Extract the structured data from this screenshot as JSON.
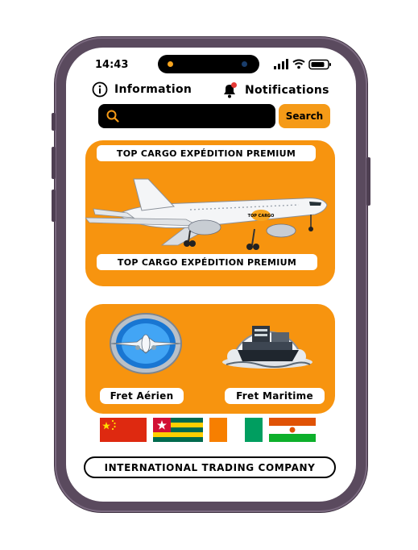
{
  "status_bar": {
    "time": "14:43"
  },
  "top_nav": {
    "information_label": "Information",
    "notifications_label": "Notifications"
  },
  "search": {
    "placeholder": "",
    "button_label": "Search"
  },
  "banner": {
    "title_top": "TOP CARGO EXPÉDITION PREMIUM",
    "title_bottom": "TOP CARGO EXPÉDITION PREMIUM",
    "plane_logo_text": "TOP CARGO"
  },
  "services": {
    "air_label": "Fret Aérien",
    "sea_label": "Fret Maritime"
  },
  "flags": [
    "China",
    "Togo",
    "Côte d'Ivoire",
    "Niger"
  ],
  "footer": {
    "company_label": "INTERNATIONAL TRADING COMPANY"
  },
  "colors": {
    "accent": "#f7940f",
    "search_bar": "#000000",
    "frame": "#5a4a5e"
  },
  "icons": [
    "info-icon",
    "bell-icon",
    "search-icon",
    "signal-icon",
    "wifi-icon",
    "battery-icon"
  ]
}
